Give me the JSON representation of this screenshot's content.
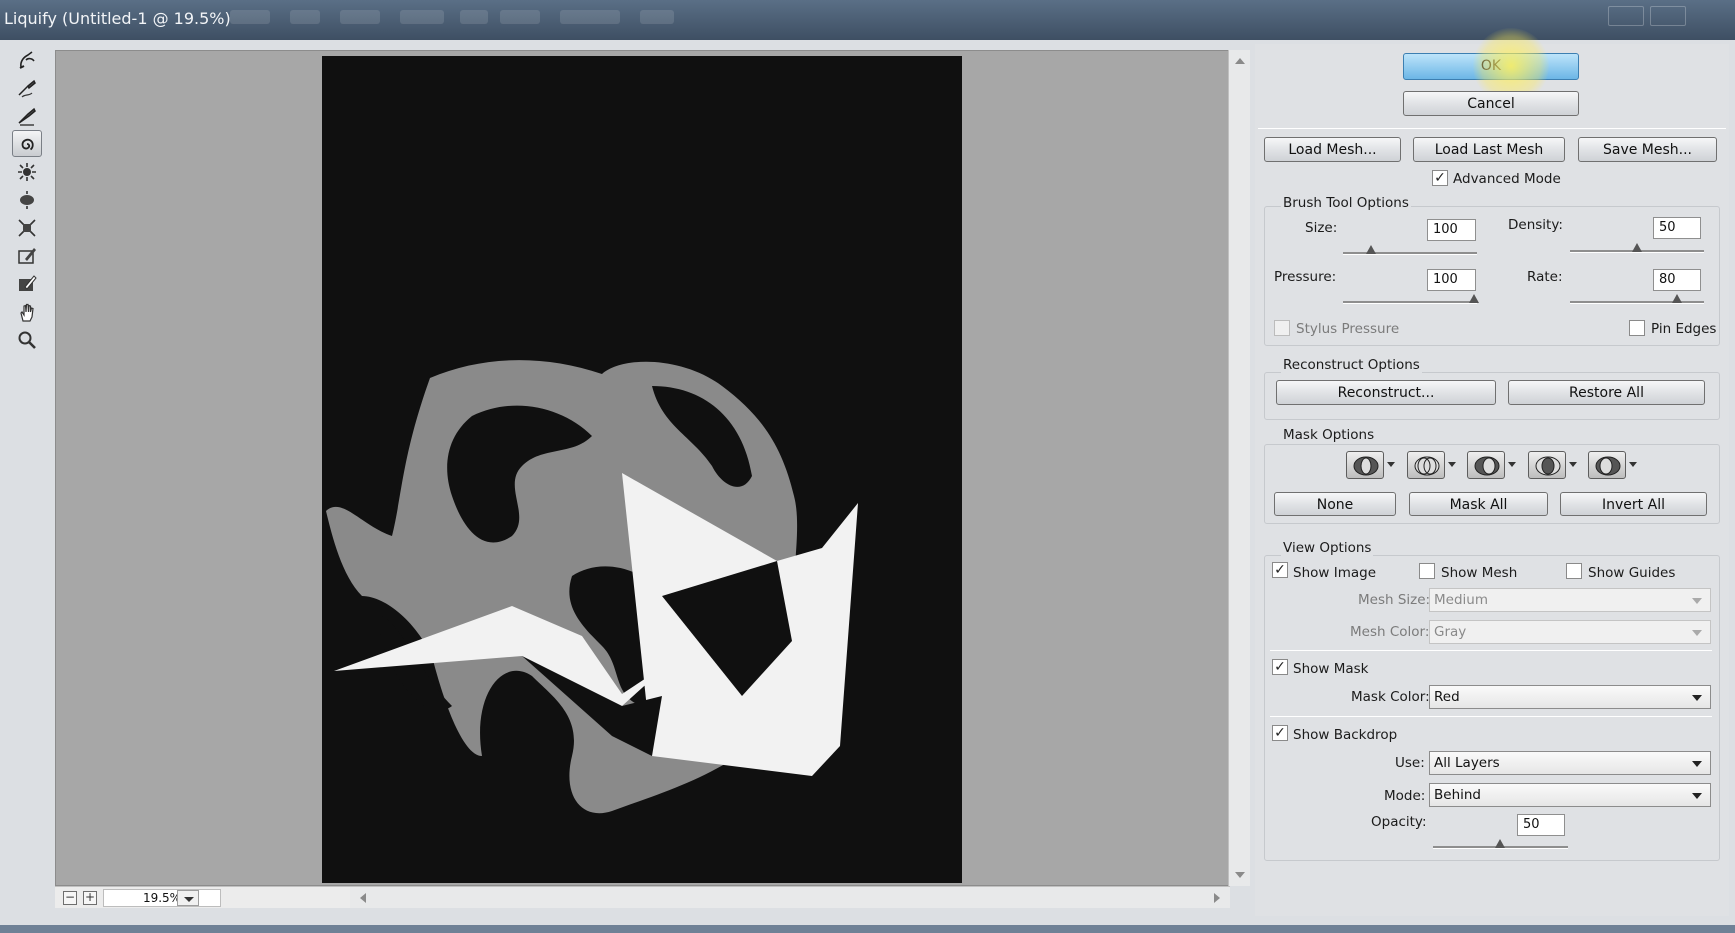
{
  "window": {
    "title": "Liquify (Untitled-1 @ 19.5%)"
  },
  "tools": [
    {
      "name": "forward-warp-icon"
    },
    {
      "name": "reconstruct-tool-icon"
    },
    {
      "name": "smooth-tool-icon"
    },
    {
      "name": "twirl-clockwise-icon",
      "selected": true
    },
    {
      "name": "pucker-tool-icon"
    },
    {
      "name": "bloat-tool-icon"
    },
    {
      "name": "push-left-icon"
    },
    {
      "name": "freeze-mask-icon"
    },
    {
      "name": "thaw-mask-icon"
    },
    {
      "name": "hand-icon"
    },
    {
      "name": "zoom-icon"
    }
  ],
  "zoom": {
    "value": "19.5%",
    "minus": "−",
    "plus": "+"
  },
  "buttons": {
    "ok": "OK",
    "cancel": "Cancel",
    "load_mesh": "Load Mesh...",
    "load_last_mesh": "Load Last Mesh",
    "save_mesh": "Save Mesh..."
  },
  "advanced_mode": {
    "label": "Advanced Mode",
    "checked": true
  },
  "brush_options": {
    "heading": "Brush Tool Options",
    "size": {
      "label": "Size:",
      "value": "100"
    },
    "density": {
      "label": "Density:",
      "value": "50"
    },
    "pressure": {
      "label": "Pressure:",
      "value": "100"
    },
    "rate": {
      "label": "Rate:",
      "value": "80"
    },
    "stylus_pressure": {
      "label": "Stylus Pressure",
      "checked": false
    },
    "pin_edges": {
      "label": "Pin Edges",
      "checked": false
    }
  },
  "reconstruct_options": {
    "heading": "Reconstruct Options",
    "reconstruct": "Reconstruct...",
    "restore_all": "Restore All"
  },
  "mask_options": {
    "heading": "Mask Options",
    "none": "None",
    "mask_all": "Mask All",
    "invert_all": "Invert All"
  },
  "view_options": {
    "heading": "View Options",
    "show_image": {
      "label": "Show Image",
      "checked": true
    },
    "show_mesh": {
      "label": "Show Mesh",
      "checked": false
    },
    "show_guides": {
      "label": "Show Guides",
      "checked": false
    },
    "mesh_size": {
      "label": "Mesh Size:",
      "value": "Medium"
    },
    "mesh_color": {
      "label": "Mesh Color:",
      "value": "Gray"
    },
    "show_mask": {
      "label": "Show Mask",
      "checked": true
    },
    "mask_color": {
      "label": "Mask Color:",
      "value": "Red"
    },
    "show_backdrop": {
      "label": "Show Backdrop",
      "checked": true
    },
    "use": {
      "label": "Use:",
      "value": "All Layers"
    },
    "mode": {
      "label": "Mode:",
      "value": "Behind"
    },
    "opacity": {
      "label": "Opacity:",
      "value": "50"
    }
  },
  "check_glyph": "✓",
  "colors": {
    "canvas_bg": "#a7a7a7",
    "artboard": "#101010",
    "gray_shape": "#8a8a8a",
    "white_shape": "#f2f2f2",
    "ok_blue": "#6cb6e6"
  }
}
